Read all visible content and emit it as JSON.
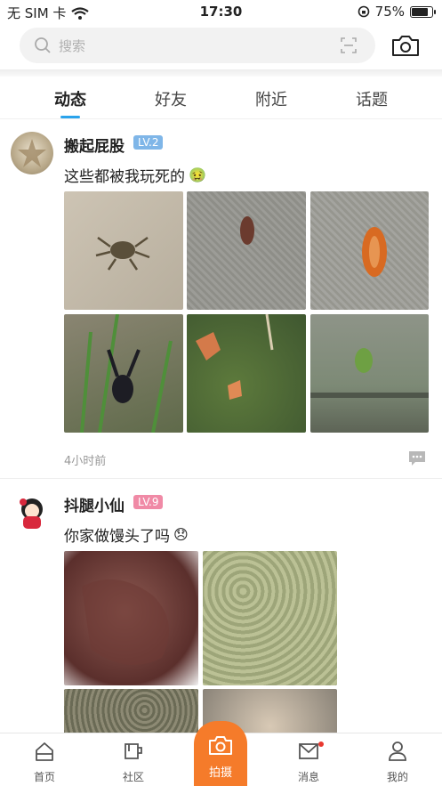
{
  "status_bar": {
    "carrier": "无 SIM 卡",
    "time": "17:30",
    "battery": "75%"
  },
  "search": {
    "placeholder": "搜索"
  },
  "tabs": [
    {
      "label": "动态",
      "active": true
    },
    {
      "label": "好友",
      "active": false
    },
    {
      "label": "附近",
      "active": false
    },
    {
      "label": "话题",
      "active": false
    }
  ],
  "posts": [
    {
      "username": "搬起屁股",
      "level": "LV.2",
      "level_color": "#7fb6e8",
      "text": "这些都被我玩死的",
      "emoji": "🤢",
      "time": "4小时前"
    },
    {
      "username": "抖腿小仙",
      "level": "LV.9",
      "level_color": "#f08aa6",
      "text": "你家做馒头了吗",
      "emoji": "😞"
    }
  ],
  "bottom_nav": {
    "home": "首页",
    "community": "社区",
    "shoot": "拍摄",
    "messages": "消息",
    "me": "我的"
  },
  "colors": {
    "accent": "#f57b2a",
    "tab_indicator": "#2aa3ec"
  }
}
